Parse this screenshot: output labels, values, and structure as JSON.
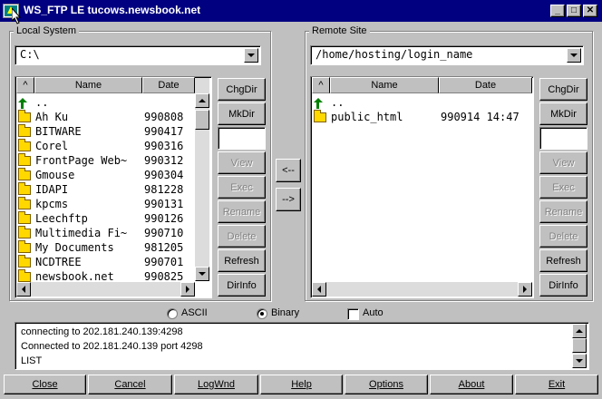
{
  "window": {
    "title": "WS_FTP LE tucows.newsbook.net",
    "minimize_glyph": "_",
    "maximize_glyph": "□",
    "close_glyph": "✕"
  },
  "local": {
    "group_label": "Local System",
    "path": "C:\\",
    "columns": {
      "sort": "^",
      "name": "Name",
      "date": "Date"
    },
    "parent_entry": "..",
    "files": [
      {
        "name": "Ah Ku",
        "date": "990808"
      },
      {
        "name": "BITWARE",
        "date": "990417"
      },
      {
        "name": "Corel",
        "date": "990316"
      },
      {
        "name": "FrontPage Web~",
        "date": "990312"
      },
      {
        "name": "Gmouse",
        "date": "990304"
      },
      {
        "name": "IDAPI",
        "date": "981228"
      },
      {
        "name": "kpcms",
        "date": "990131"
      },
      {
        "name": "Leechftp",
        "date": "990126"
      },
      {
        "name": "Multimedia Fi~",
        "date": "990710"
      },
      {
        "name": "My Documents",
        "date": "981205"
      },
      {
        "name": "NCDTREE",
        "date": "990701"
      },
      {
        "name": "newsbook.net",
        "date": "990825"
      }
    ],
    "buttons": [
      "ChgDir",
      "MkDir",
      "View",
      "Exec",
      "Rename",
      "Delete",
      "Refresh",
      "DirInfo"
    ]
  },
  "remote": {
    "group_label": "Remote Site",
    "path": "/home/hosting/login_name",
    "columns": {
      "sort": "^",
      "name": "Name",
      "date": "Date"
    },
    "parent_entry": "..",
    "files": [
      {
        "name": "public_html",
        "date": "990914 14:47"
      }
    ],
    "buttons": [
      "ChgDir",
      "MkDir",
      "View",
      "Exec",
      "Rename",
      "Delete",
      "Refresh",
      "DirInfo"
    ]
  },
  "transfer": {
    "to_local": "<--",
    "to_remote": "-->"
  },
  "mode": {
    "ascii_label": "ASCII",
    "binary_label": "Binary",
    "auto_label": "Auto",
    "selected": "Binary",
    "auto_checked": false
  },
  "log": {
    "lines": [
      "connecting to 202.181.240.139:4298",
      "Connected to 202.181.240.139 port 4298",
      "LIST"
    ]
  },
  "bottom_buttons": [
    "Close",
    "Cancel",
    "LogWnd",
    "Help",
    "Options",
    "About",
    "Exit"
  ],
  "colors": {
    "titlebar": "#000080",
    "face": "#c0c0c0",
    "folder": "#ffd800",
    "up_arrow": "#008000"
  }
}
